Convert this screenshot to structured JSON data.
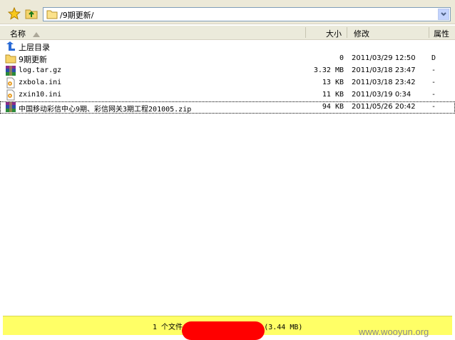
{
  "address": {
    "path": "/9期更新/"
  },
  "columns": {
    "name": "名称",
    "size": "大小",
    "modified": "修改",
    "attr": "属性"
  },
  "files": [
    {
      "name": "上层目录",
      "size": "",
      "date": "",
      "attr": "",
      "icon": "up-arrow-icon"
    },
    {
      "name": "9期更新",
      "size": "0",
      "date": "2011/03/29 12:50",
      "attr": "D",
      "icon": "folder-icon"
    },
    {
      "name": "log.tar.gz",
      "size": "3.32 MB",
      "date": "2011/03/18 23:47",
      "attr": "-",
      "icon": "archive-icon"
    },
    {
      "name": "zxbola.ini",
      "size": "13 KB",
      "date": "2011/03/18 23:42",
      "attr": "-",
      "icon": "ini-file-icon"
    },
    {
      "name": "zxin10.ini",
      "size": "11 KB",
      "date": "2011/03/19 0:34",
      "attr": "-",
      "icon": "ini-file-icon"
    },
    {
      "name": "中国移动彩信中心9期、彩信网关3期工程201005.zip",
      "size": "94 KB",
      "date": "2011/05/26 20:42",
      "attr": "-",
      "icon": "archive-icon"
    }
  ],
  "status": {
    "text": "1 个文件，      个文件，共 5 (3.44 MB)"
  },
  "watermark": "www.wooyun.org",
  "colors": {
    "status_bg": "#ffff66",
    "redaction": "#ff0000"
  }
}
